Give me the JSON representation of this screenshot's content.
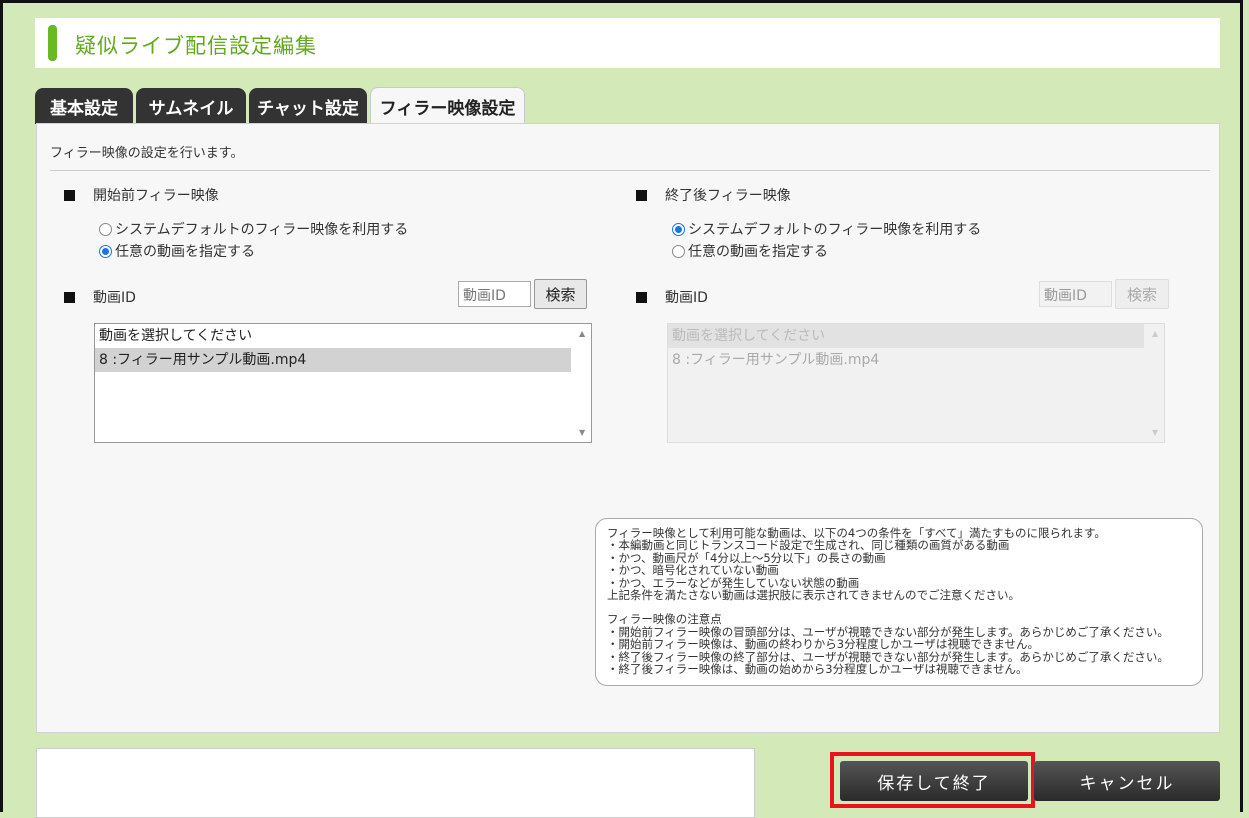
{
  "title": "疑似ライブ配信設定編集",
  "tabs": [
    {
      "label": "基本設定",
      "active": false
    },
    {
      "label": "サムネイル",
      "active": false
    },
    {
      "label": "チャット設定",
      "active": false
    },
    {
      "label": "フィラー映像設定",
      "active": true
    }
  ],
  "description": "フィラー映像の設定を行います。",
  "before": {
    "section_label": "開始前フィラー映像",
    "radios": [
      {
        "label": "システムデフォルトのフィラー映像を利用する",
        "checked": false
      },
      {
        "label": "任意の動画を指定する",
        "checked": true
      }
    ],
    "video_id_label": "動画ID",
    "video_id_placeholder": "動画ID",
    "search_label": "検索",
    "options": [
      "動画を選択してください",
      "8 :フィラー用サンプル動画.mp4"
    ],
    "selected_index": 1,
    "enabled": true
  },
  "after": {
    "section_label": "終了後フィラー映像",
    "radios": [
      {
        "label": "システムデフォルトのフィラー映像を利用する",
        "checked": true
      },
      {
        "label": "任意の動画を指定する",
        "checked": false
      }
    ],
    "video_id_label": "動画ID",
    "video_id_placeholder": "動画ID",
    "search_label": "検索",
    "options": [
      "動画を選択してください",
      "8 :フィラー用サンプル動画.mp4"
    ],
    "selected_index": 0,
    "enabled": false
  },
  "notes": [
    "フィラー映像として利用可能な動画は、以下の4つの条件を「すべて」満たすものに限られます。",
    "・本編動画と同じトランスコード設定で生成され、同じ種類の画質がある動画",
    "・かつ、動画尺が「4分以上～5分以下」の長さの動画",
    "・かつ、暗号化されていない動画",
    "・かつ、エラーなどが発生していない状態の動画",
    "上記条件を満たさない動画は選択肢に表示されてきませんのでご注意ください。",
    "",
    "フィラー映像の注意点",
    "・開始前フィラー映像の冒頭部分は、ユーザが視聴できない部分が発生します。あらかじめご了承ください。",
    "・開始前フィラー映像は、動画の終わりから3分程度しかユーザは視聴できません。",
    "・終了後フィラー映像の終了部分は、ユーザが視聴できない部分が発生します。あらかじめご了承ください。",
    "・終了後フィラー映像は、動画の始めから3分程度しかユーザは視聴できません。"
  ],
  "buttons": {
    "save_label": "保存して終了",
    "cancel_label": "キャンセル"
  },
  "colors": {
    "background": "#d4e9b8",
    "title_accent": "#69b923",
    "highlight": "#e8141c",
    "radio_on": "#1a73e8"
  }
}
